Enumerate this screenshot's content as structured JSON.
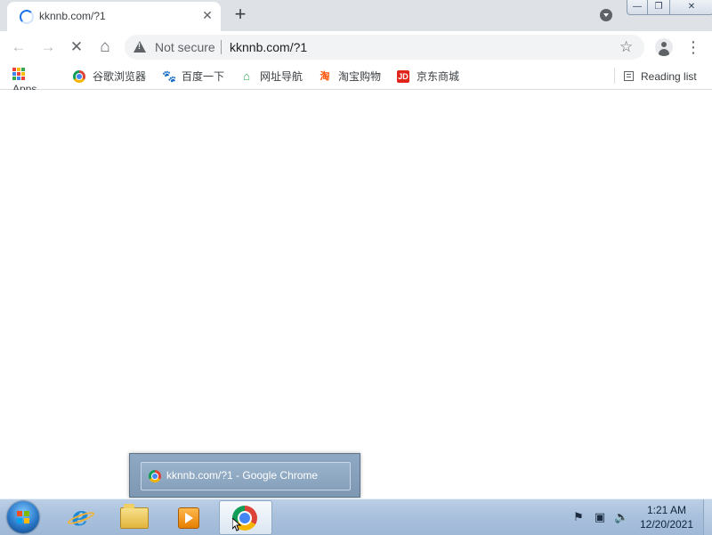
{
  "browser": {
    "tab": {
      "title": "kknnb.com/?1",
      "close_glyph": "✕"
    },
    "new_tab_glyph": "+",
    "window_controls": {
      "minimize": "—",
      "maximize": "❐",
      "close": "✕"
    },
    "toolbar": {
      "back_glyph": "←",
      "forward_glyph": "→",
      "stop_glyph": "✕",
      "home_glyph": "⌂",
      "security_text": "Not secure",
      "url": "kknnb.com/?1",
      "bookmark_glyph": "☆",
      "menu_glyph": "⋮"
    },
    "bookmarks": [
      {
        "label": "Apps",
        "icon": "apps-grid-icon"
      },
      {
        "label": "谷歌浏览器",
        "icon": "chrome-icon"
      },
      {
        "label": "百度一下",
        "icon": "baidu-paw-icon"
      },
      {
        "label": "网址导航",
        "icon": "house-icon"
      },
      {
        "label": "淘宝购物",
        "icon": "taobao-icon"
      },
      {
        "label": "京东商城",
        "icon": "jd-icon"
      }
    ],
    "jd_icon_text": "JD",
    "taobao_icon_text": "淘",
    "reading_list_label": "Reading list"
  },
  "taskbar": {
    "preview_title": "kknnb.com/?1 - Google Chrome",
    "apps": [
      "internet-explorer",
      "file-explorer",
      "media-player",
      "google-chrome"
    ],
    "tray": {
      "time": "1:21 AM",
      "date": "12/20/2021"
    }
  },
  "colors": {
    "tab_strip": "#dee1e6",
    "omnibox": "#f1f3f4",
    "taskbar": "#a9c1dd",
    "spinner": "#1a73e8"
  }
}
